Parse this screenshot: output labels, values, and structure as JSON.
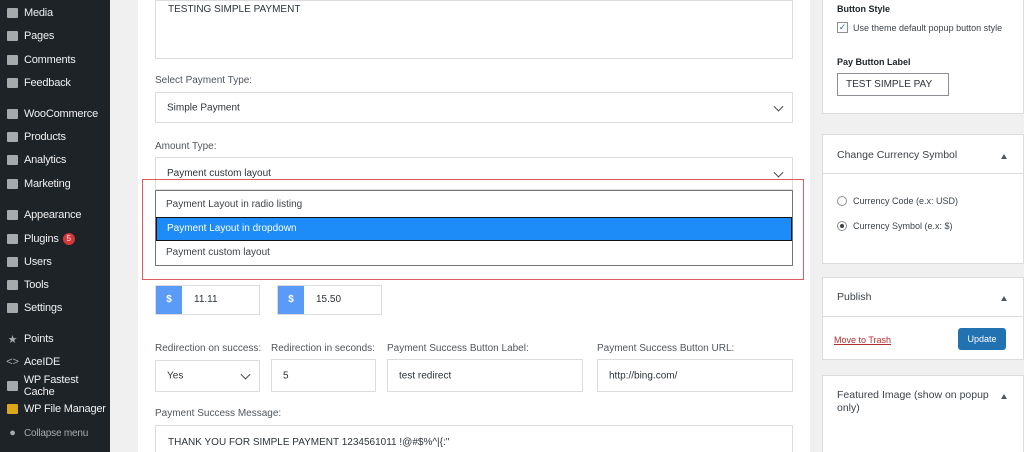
{
  "sidebar": {
    "items": [
      {
        "label": "Media",
        "icon": "media-icon"
      },
      {
        "label": "Pages",
        "icon": "pages-icon"
      },
      {
        "label": "Comments",
        "icon": "comments-icon"
      },
      {
        "label": "Feedback",
        "icon": "feedback-icon"
      },
      {
        "label": "WooCommerce",
        "icon": "woocommerce-icon"
      },
      {
        "label": "Products",
        "icon": "products-icon"
      },
      {
        "label": "Analytics",
        "icon": "analytics-icon"
      },
      {
        "label": "Marketing",
        "icon": "marketing-icon"
      },
      {
        "label": "Appearance",
        "icon": "appearance-icon"
      },
      {
        "label": "Plugins",
        "icon": "plugins-icon",
        "badge": "5"
      },
      {
        "label": "Users",
        "icon": "users-icon"
      },
      {
        "label": "Tools",
        "icon": "tools-icon"
      },
      {
        "label": "Settings",
        "icon": "settings-icon"
      },
      {
        "label": "Points",
        "icon": "star-icon"
      },
      {
        "label": "AceIDE",
        "icon": "code-icon"
      },
      {
        "label": "WP Fastest Cache",
        "icon": "cache-icon"
      },
      {
        "label": "WP File Manager",
        "icon": "folder-icon"
      },
      {
        "label": "Collapse menu",
        "icon": "collapse-icon"
      }
    ]
  },
  "form": {
    "title_text": "TESTING SIMPLE PAYMENT",
    "payment_type_label": "Select Payment Type:",
    "payment_type_value": "Simple Payment",
    "amount_type_label": "Amount Type:",
    "amount_type_value": "Payment custom layout",
    "dropdown_options": [
      "Payment Layout in radio listing",
      "Payment Layout in dropdown",
      "Payment custom layout"
    ],
    "selected_option": "Payment Layout in dropdown",
    "amounts": [
      {
        "symbol": "$",
        "value": "11.11"
      },
      {
        "symbol": "$",
        "value": "15.50"
      }
    ],
    "redirection_success_label": "Redirection on success:",
    "redirection_success_value": "Yes",
    "redirection_seconds_label": "Redirection in seconds:",
    "redirection_seconds_value": "5",
    "success_button_label_label": "Payment Success Button Label:",
    "success_button_label_value": "test redirect",
    "success_button_url_label": "Payment Success Button URL:",
    "success_button_url_value": "http://bing.com/",
    "success_message_label": "Payment Success Message:",
    "success_message_value": "THANK YOU FOR SIMPLE PAYMENT 1234561011 !@#$%^|{:\""
  },
  "right": {
    "button_style_label": "Button Style",
    "use_theme_checkbox": "Use theme default popup button style",
    "pay_button_label": "Pay Button Label",
    "pay_button_value": "TEST SIMPLE PAY",
    "currency_panel_title": "Change Currency Symbol",
    "currency_code": "Currency Code (e.x: USD)",
    "currency_symbol": "Currency Symbol (e.x: $)",
    "publish_title": "Publish",
    "move_to_trash": "Move to Trash",
    "update": "Update",
    "featured_title": "Featured Image (show on popup only)"
  }
}
